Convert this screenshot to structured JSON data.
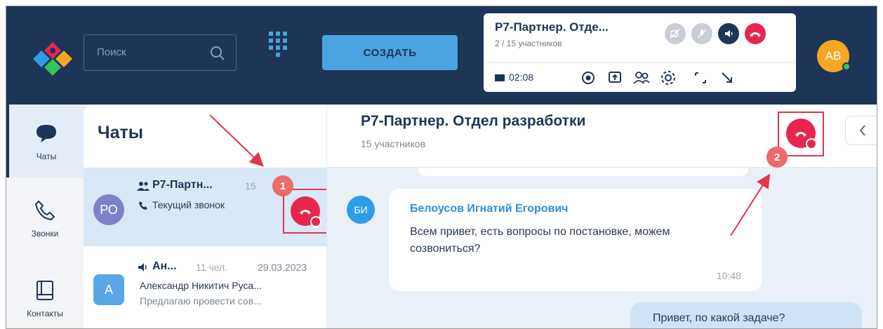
{
  "topbar": {
    "search_placeholder": "Поиск",
    "create_label": "СОЗДАТЬ",
    "user_initials": "АВ"
  },
  "call_widget": {
    "title": "Р7-Партнер. Отде...",
    "participants": "2 / 15 участников",
    "timer": "02:08"
  },
  "nav": [
    {
      "label": "Чаты",
      "icon": "chat-icon"
    },
    {
      "label": "Звонки",
      "icon": "phone-icon"
    },
    {
      "label": "Контакты",
      "icon": "contacts-icon"
    }
  ],
  "chatlist": {
    "title": "Чаты",
    "items": [
      {
        "initials": "РО",
        "name": "Р7-Партн...",
        "count": "15",
        "line1": "Текущий звонок",
        "color": "#7b83c9"
      },
      {
        "initials": "А",
        "name": "Ан...",
        "count": "11 чел.",
        "date": "29.03.2023",
        "line1": "Александр Никитич Руса...",
        "line2": "Предлагаю провести сов...",
        "color": "#5aa7e8"
      }
    ]
  },
  "chat": {
    "title": "Р7-Партнер. Отдел разработки",
    "subtitle": "15 участников",
    "messages": [
      {
        "initials": "БИ",
        "author": "Белоусов Игнатий Егорович",
        "text": "Всем привет, есть вопросы по постановке, можем созвониться?",
        "time": "10:48"
      },
      {
        "text": "Привет, по какой задаче?"
      }
    ]
  },
  "annotations": [
    "1",
    "2"
  ],
  "colors": {
    "brand_dark": "#1d3557",
    "accent": "#4aa3df",
    "hangup": "#e8264d",
    "annotation": "#e0364e"
  }
}
